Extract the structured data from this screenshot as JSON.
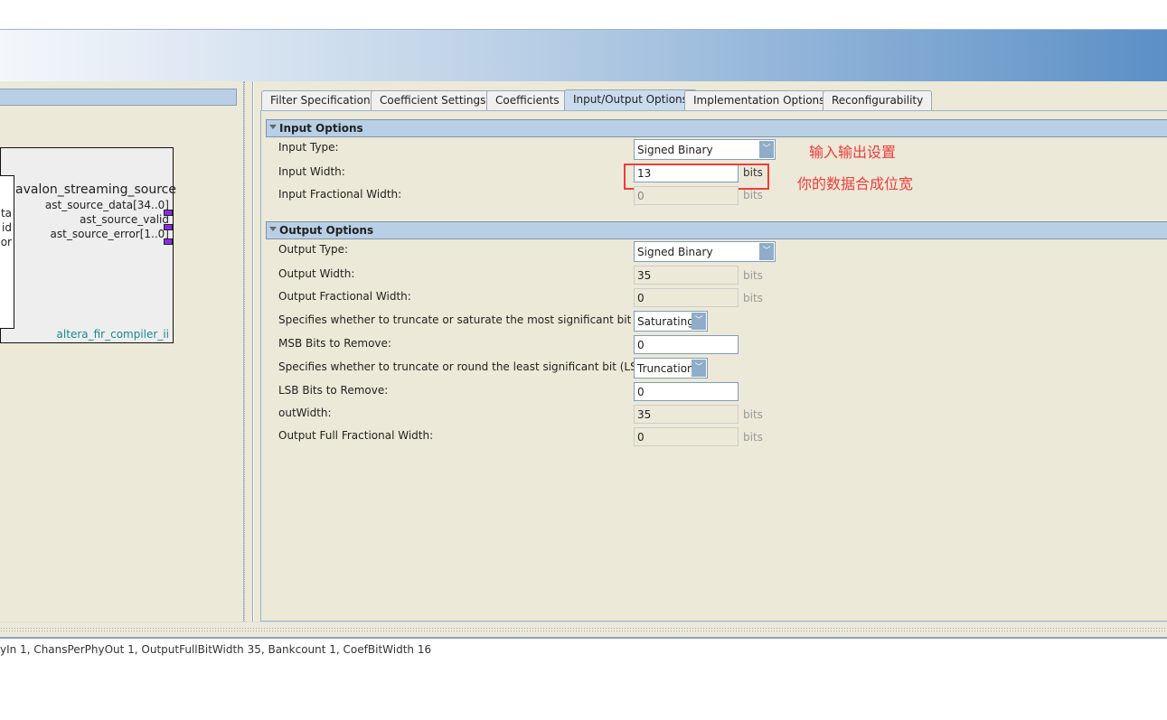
{
  "left_panel": {
    "block_interface": "avalon_streaming_source",
    "signals": [
      "ast_source_data[34..0]",
      "ast_source_valid",
      "ast_source_error[1..0]"
    ],
    "inner_signals": [
      "ta",
      "id",
      "or"
    ],
    "component_name": "altera_fir_compiler_ii"
  },
  "tabs": [
    "Filter Specification",
    "Coefficient Settings",
    "Coefficients",
    "Input/Output Options",
    "Implementation Options",
    "Reconfigurability"
  ],
  "selected_tab": "Input/Output Options",
  "input_options": {
    "title": "Input Options",
    "input_type_label": "Input Type:",
    "input_type": "Signed Binary",
    "input_width_label": "Input Width:",
    "input_width": "13",
    "input_frac_label": "Input Fractional Width:",
    "input_frac": "0",
    "units": "bits"
  },
  "output_options": {
    "title": "Output Options",
    "output_type_label": "Output Type:",
    "output_type": "Signed Binary",
    "output_width_label": "Output Width:",
    "output_width": "35",
    "output_frac_label": "Output Fractional Width:",
    "output_frac": "0",
    "msb_label": "Specifies whether to truncate or saturate the most significant bit (MSB).:",
    "msb_mode": "Saturating",
    "msb_remove_label": "MSB Bits to Remove:",
    "msb_remove": "0",
    "lsb_label": "Specifies whether to truncate or round the least significant bit (LSB).:",
    "lsb_mode": "Truncation",
    "lsb_remove_label": "LSB Bits to Remove:",
    "lsb_remove": "0",
    "outwidth_label": "outWidth:",
    "outwidth": "35",
    "full_frac_label": "Output Full Fractional Width:",
    "full_frac": "0",
    "units": "bits"
  },
  "annotations": {
    "io_settings": "输入输出设置",
    "data_width": "你的数据合成位宽",
    "highlight_color": "#f03c3c"
  },
  "status_text": "yIn 1, ChansPerPhyOut 1, OutputFullBitWidth 35, Bankcount 1, CoefBitWidth 16"
}
